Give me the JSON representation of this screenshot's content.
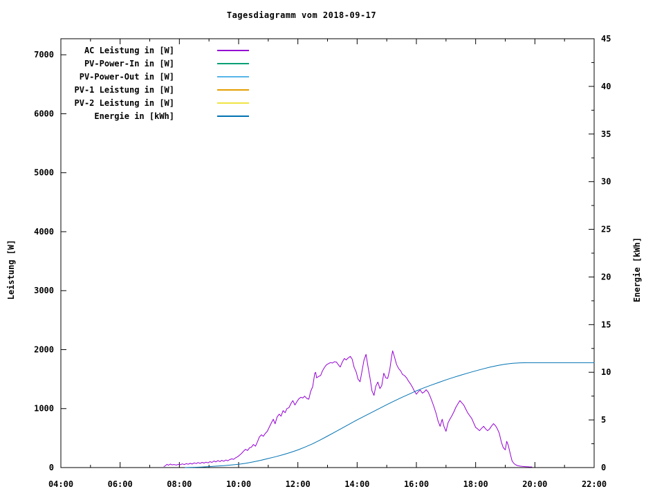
{
  "title": "Tagesdiagramm vom 2018-09-17",
  "legend": [
    {
      "label": "AC Leistung in [W]",
      "color": "#9400d3"
    },
    {
      "label": "PV-Power-In in [W]",
      "color": "#009e73"
    },
    {
      "label": "PV-Power-Out in [W]",
      "color": "#56b4e9"
    },
    {
      "label": "PV-1 Leistung in [W]",
      "color": "#e69f00"
    },
    {
      "label": "PV-2 Leistung in [W]",
      "color": "#f0e442"
    },
    {
      "label": "Energie in [kWh]",
      "color": "#0072b2"
    }
  ],
  "chart_data": {
    "type": "line",
    "title": "Tagesdiagramm vom 2018-09-17",
    "grid": false,
    "legend_position": "top-left",
    "background": "#ffffff",
    "x_axis": {
      "label": "",
      "unit": "time",
      "range": [
        4,
        22
      ],
      "major_tick_hours": 2,
      "minor_tick_hours": 1,
      "tick_labels": [
        "04:00",
        "06:00",
        "08:00",
        "10:00",
        "12:00",
        "14:00",
        "16:00",
        "18:00",
        "20:00",
        "22:00"
      ]
    },
    "left_axis": {
      "label": "Leistung [W]",
      "range": [
        0,
        7272
      ],
      "tick_step": 1000,
      "tick_labels": [
        "0",
        "1000",
        "2000",
        "3000",
        "4000",
        "5000",
        "6000",
        "7000"
      ]
    },
    "right_axis": {
      "label": "Energie [kWh]",
      "range": [
        0,
        45
      ],
      "tick_step": 5,
      "minor_tick_step": 2.5,
      "tick_labels": [
        "0",
        "5",
        "10",
        "15",
        "20",
        "25",
        "30",
        "35",
        "40",
        "45"
      ]
    },
    "series": [
      {
        "id": "ac-leistung",
        "name": "AC Leistung in [W]",
        "color": "#9400d3",
        "axis": "left",
        "points": [
          [
            7.48,
            18
          ],
          [
            7.53,
            32
          ],
          [
            7.58,
            55
          ],
          [
            7.63,
            40
          ],
          [
            7.7,
            60
          ],
          [
            7.75,
            46
          ],
          [
            7.82,
            52
          ],
          [
            7.9,
            42
          ],
          [
            7.97,
            55
          ],
          [
            8.03,
            48
          ],
          [
            8.1,
            62
          ],
          [
            8.17,
            52
          ],
          [
            8.23,
            66
          ],
          [
            8.3,
            58
          ],
          [
            8.37,
            72
          ],
          [
            8.43,
            60
          ],
          [
            8.5,
            80
          ],
          [
            8.57,
            68
          ],
          [
            8.63,
            85
          ],
          [
            8.7,
            72
          ],
          [
            8.77,
            88
          ],
          [
            8.83,
            76
          ],
          [
            8.9,
            92
          ],
          [
            8.97,
            80
          ],
          [
            9.03,
            100
          ],
          [
            9.1,
            88
          ],
          [
            9.17,
            112
          ],
          [
            9.23,
            96
          ],
          [
            9.3,
            118
          ],
          [
            9.37,
            102
          ],
          [
            9.43,
            122
          ],
          [
            9.5,
            108
          ],
          [
            9.57,
            128
          ],
          [
            9.63,
            115
          ],
          [
            9.7,
            135
          ],
          [
            9.77,
            148
          ],
          [
            9.83,
            140
          ],
          [
            9.9,
            165
          ],
          [
            9.97,
            185
          ],
          [
            10.03,
            210
          ],
          [
            10.1,
            240
          ],
          [
            10.17,
            280
          ],
          [
            10.23,
            310
          ],
          [
            10.3,
            290
          ],
          [
            10.37,
            335
          ],
          [
            10.43,
            345
          ],
          [
            10.5,
            392
          ],
          [
            10.57,
            362
          ],
          [
            10.63,
            430
          ],
          [
            10.7,
            520
          ],
          [
            10.77,
            556
          ],
          [
            10.83,
            530
          ],
          [
            10.9,
            580
          ],
          [
            10.97,
            616
          ],
          [
            11.03,
            680
          ],
          [
            11.1,
            752
          ],
          [
            11.17,
            820
          ],
          [
            11.23,
            742
          ],
          [
            11.3,
            860
          ],
          [
            11.37,
            905
          ],
          [
            11.43,
            872
          ],
          [
            11.5,
            965
          ],
          [
            11.57,
            930
          ],
          [
            11.63,
            1000
          ],
          [
            11.7,
            1016
          ],
          [
            11.77,
            1090
          ],
          [
            11.83,
            1135
          ],
          [
            11.9,
            1062
          ],
          [
            11.97,
            1120
          ],
          [
            12.03,
            1165
          ],
          [
            12.1,
            1192
          ],
          [
            12.17,
            1180
          ],
          [
            12.23,
            1212
          ],
          [
            12.3,
            1172
          ],
          [
            12.37,
            1160
          ],
          [
            12.43,
            1290
          ],
          [
            12.5,
            1372
          ],
          [
            12.57,
            1600
          ],
          [
            12.6,
            1615
          ],
          [
            12.63,
            1522
          ],
          [
            12.7,
            1545
          ],
          [
            12.77,
            1562
          ],
          [
            12.83,
            1640
          ],
          [
            12.9,
            1700
          ],
          [
            12.97,
            1745
          ],
          [
            13.03,
            1762
          ],
          [
            13.1,
            1780
          ],
          [
            13.17,
            1772
          ],
          [
            13.23,
            1795
          ],
          [
            13.3,
            1790
          ],
          [
            13.37,
            1742
          ],
          [
            13.43,
            1705
          ],
          [
            13.5,
            1790
          ],
          [
            13.57,
            1850
          ],
          [
            13.63,
            1825
          ],
          [
            13.7,
            1860
          ],
          [
            13.77,
            1885
          ],
          [
            13.83,
            1840
          ],
          [
            13.9,
            1700
          ],
          [
            13.97,
            1620
          ],
          [
            14.03,
            1500
          ],
          [
            14.1,
            1455
          ],
          [
            14.17,
            1650
          ],
          [
            14.23,
            1820
          ],
          [
            14.3,
            1920
          ],
          [
            14.37,
            1700
          ],
          [
            14.43,
            1530
          ],
          [
            14.5,
            1300
          ],
          [
            14.57,
            1225
          ],
          [
            14.63,
            1380
          ],
          [
            14.7,
            1450
          ],
          [
            14.77,
            1340
          ],
          [
            14.83,
            1390
          ],
          [
            14.9,
            1600
          ],
          [
            14.97,
            1520
          ],
          [
            15.03,
            1512
          ],
          [
            15.1,
            1660
          ],
          [
            15.17,
            1900
          ],
          [
            15.2,
            1980
          ],
          [
            15.27,
            1860
          ],
          [
            15.33,
            1750
          ],
          [
            15.4,
            1680
          ],
          [
            15.47,
            1640
          ],
          [
            15.53,
            1580
          ],
          [
            15.6,
            1560
          ],
          [
            15.67,
            1520
          ],
          [
            15.73,
            1470
          ],
          [
            15.8,
            1420
          ],
          [
            15.87,
            1360
          ],
          [
            15.93,
            1300
          ],
          [
            16,
            1245
          ],
          [
            16.07,
            1290
          ],
          [
            16.13,
            1312
          ],
          [
            16.2,
            1262
          ],
          [
            16.27,
            1285
          ],
          [
            16.33,
            1320
          ],
          [
            16.4,
            1280
          ],
          [
            16.47,
            1200
          ],
          [
            16.53,
            1120
          ],
          [
            16.6,
            1020
          ],
          [
            16.67,
            910
          ],
          [
            16.73,
            790
          ],
          [
            16.8,
            700
          ],
          [
            16.87,
            820
          ],
          [
            16.93,
            700
          ],
          [
            17,
            615
          ],
          [
            17.07,
            760
          ],
          [
            17.13,
            820
          ],
          [
            17.2,
            880
          ],
          [
            17.27,
            950
          ],
          [
            17.33,
            1020
          ],
          [
            17.4,
            1080
          ],
          [
            17.47,
            1135
          ],
          [
            17.53,
            1100
          ],
          [
            17.6,
            1060
          ],
          [
            17.67,
            990
          ],
          [
            17.73,
            930
          ],
          [
            17.8,
            880
          ],
          [
            17.87,
            830
          ],
          [
            17.93,
            760
          ],
          [
            18,
            680
          ],
          [
            18.07,
            655
          ],
          [
            18.13,
            625
          ],
          [
            18.2,
            665
          ],
          [
            18.27,
            700
          ],
          [
            18.33,
            660
          ],
          [
            18.4,
            625
          ],
          [
            18.47,
            655
          ],
          [
            18.53,
            700
          ],
          [
            18.6,
            745
          ],
          [
            18.67,
            710
          ],
          [
            18.73,
            660
          ],
          [
            18.8,
            580
          ],
          [
            18.87,
            430
          ],
          [
            18.93,
            340
          ],
          [
            19,
            300
          ],
          [
            19.05,
            445
          ],
          [
            19.1,
            380
          ],
          [
            19.17,
            230
          ],
          [
            19.23,
            110
          ],
          [
            19.3,
            65
          ],
          [
            19.37,
            42
          ],
          [
            19.43,
            30
          ],
          [
            19.5,
            25
          ],
          [
            19.57,
            20
          ],
          [
            19.63,
            18
          ],
          [
            19.7,
            15
          ],
          [
            19.8,
            12
          ],
          [
            19.9,
            10
          ]
        ]
      },
      {
        "id": "pv-power-in",
        "name": "PV-Power-In in [W]",
        "color": "#009e73",
        "axis": "left",
        "points": []
      },
      {
        "id": "pv-power-out",
        "name": "PV-Power-Out in [W]",
        "color": "#56b4e9",
        "axis": "left",
        "points": []
      },
      {
        "id": "pv1-leistung",
        "name": "PV-1 Leistung in [W]",
        "color": "#e69f00",
        "axis": "left",
        "points": []
      },
      {
        "id": "pv2-leistung",
        "name": "PV-2 Leistung in [W]",
        "color": "#f0e442",
        "axis": "left",
        "points": []
      },
      {
        "id": "energie",
        "name": "Energie in [kWh]",
        "color": "#0072b2",
        "axis": "right",
        "points": [
          [
            8.2,
            0
          ],
          [
            8.25,
            0.01
          ],
          [
            8.5,
            0.03
          ],
          [
            8.75,
            0.06
          ],
          [
            9,
            0.1
          ],
          [
            9.25,
            0.15
          ],
          [
            9.5,
            0.2
          ],
          [
            9.75,
            0.27
          ],
          [
            10,
            0.35
          ],
          [
            10.25,
            0.46
          ],
          [
            10.5,
            0.6
          ],
          [
            10.75,
            0.76
          ],
          [
            11,
            0.95
          ],
          [
            11.25,
            1.14
          ],
          [
            11.5,
            1.35
          ],
          [
            11.75,
            1.59
          ],
          [
            12,
            1.85
          ],
          [
            12.25,
            2.16
          ],
          [
            12.5,
            2.5
          ],
          [
            12.75,
            2.89
          ],
          [
            13,
            3.3
          ],
          [
            13.25,
            3.72
          ],
          [
            13.5,
            4.15
          ],
          [
            13.75,
            4.58
          ],
          [
            14,
            5.0
          ],
          [
            14.25,
            5.4
          ],
          [
            14.5,
            5.8
          ],
          [
            14.75,
            6.2
          ],
          [
            15,
            6.6
          ],
          [
            15.25,
            6.98
          ],
          [
            15.5,
            7.35
          ],
          [
            15.75,
            7.7
          ],
          [
            16,
            8.05
          ],
          [
            16.25,
            8.36
          ],
          [
            16.5,
            8.65
          ],
          [
            16.75,
            8.93
          ],
          [
            17,
            9.2
          ],
          [
            17.25,
            9.46
          ],
          [
            17.5,
            9.7
          ],
          [
            17.75,
            9.93
          ],
          [
            18,
            10.15
          ],
          [
            18.25,
            10.36
          ],
          [
            18.5,
            10.55
          ],
          [
            18.75,
            10.71
          ],
          [
            19,
            10.85
          ],
          [
            19.25,
            10.94
          ],
          [
            19.5,
            10.99
          ],
          [
            19.75,
            11.0
          ],
          [
            20,
            11.0
          ],
          [
            21,
            11.0
          ],
          [
            22,
            11.0
          ]
        ]
      }
    ]
  }
}
